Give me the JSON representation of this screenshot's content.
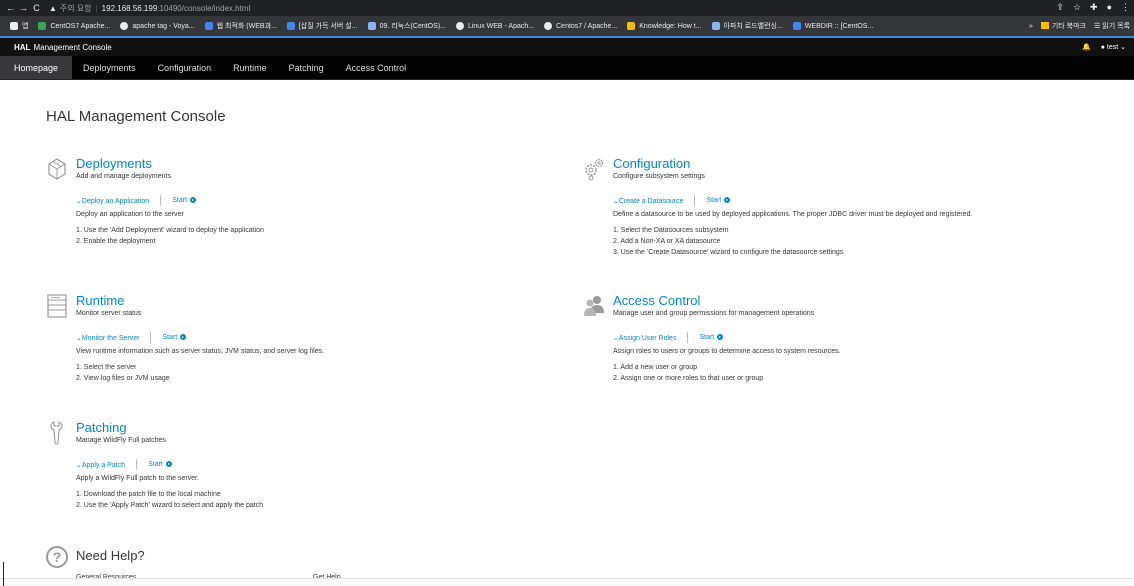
{
  "browser": {
    "back_icon": "←",
    "forward_icon": "→",
    "reload_icon": "C",
    "warning_icon": "▲",
    "insecure_label": "주의 요함",
    "url_host": "192.168.56.199",
    "url_path": ":10490/console/index.html",
    "right_icons": [
      "share-icon",
      "star-icon",
      "extension-icon",
      "profile-icon",
      "menu-icon"
    ],
    "bookmarks": [
      {
        "label": "앱",
        "color": "#e8eaed"
      },
      {
        "label": "CentOS7 Apache...",
        "color": "#34a853"
      },
      {
        "label": "apache tag - Voya...",
        "color": "#e8eaed"
      },
      {
        "label": "웹 최적화 (WEB과...",
        "color": "#4285f4"
      },
      {
        "label": "[삽질 가득 서버 설...",
        "color": "#4285f4"
      },
      {
        "label": "09. 리눅스(CentOS)...",
        "color": "#8ab4f8"
      },
      {
        "label": "Linux WEB - Apach...",
        "color": "#e8eaed"
      },
      {
        "label": "Centos7 / Apache...",
        "color": "#e8eaed"
      },
      {
        "label": "Knowledge: How t...",
        "color": "#fbbc04"
      },
      {
        "label": "아파치 로드밸런싱...",
        "color": "#8ab4f8"
      },
      {
        "label": "WEBDIR :: [CentOS...",
        "color": "#4285f4"
      }
    ],
    "overflow": "»",
    "other_bookmarks": "기타 북마크",
    "reading_list": "읽기 목록"
  },
  "header": {
    "brand_bold": "HAL",
    "brand_rest": "Management Console",
    "bell_icon": "bell-icon",
    "user_label": "test"
  },
  "nav": {
    "tabs": [
      "Homepage",
      "Deployments",
      "Configuration",
      "Runtime",
      "Patching",
      "Access Control"
    ],
    "active": "Homepage"
  },
  "main": {
    "title": "HAL Management Console",
    "sections": {
      "deployments": {
        "title": "Deployments",
        "subtitle": "Add and manage deployments",
        "action": "Deploy an Application",
        "start": "Start",
        "desc": "Deploy an application to the server",
        "steps": [
          "1. Use the 'Add Deployment' wizard to deploy the application",
          "2. Enable the deployment"
        ]
      },
      "configuration": {
        "title": "Configuration",
        "subtitle": "Configure subsystem settings",
        "action": "Create a Datasource",
        "start": "Start",
        "desc": "Define a datasource to be used by deployed applications. The proper JDBC driver must be deployed and registered.",
        "steps": [
          "1. Select the Datasources subsystem",
          "2. Add a Non-XA or XA datasource",
          "3. Use the 'Create Datasource' wizard to configure the datasource settings"
        ]
      },
      "runtime": {
        "title": "Runtime",
        "subtitle": "Monitor server status",
        "action": "Monitor the Server",
        "start": "Start",
        "desc": "View runtime information such as server status, JVM status, and server log files.",
        "steps": [
          "1. Select the server",
          "2. View log files or JVM usage"
        ]
      },
      "access": {
        "title": "Access Control",
        "subtitle": "Manage user and group permissions for management operations",
        "action": "Assign User Roles",
        "start": "Start",
        "desc": "Assign roles to users or groups to determine access to system resources.",
        "steps": [
          "1. Add a new user or group",
          "2. Assign one or more roles to that user or group"
        ]
      },
      "patching": {
        "title": "Patching",
        "subtitle": "Manage WildFly Full patches",
        "action": "Apply a Patch",
        "start": "Start",
        "desc": "Apply a WildFly Full patch to the server.",
        "steps": [
          "1. Download the patch file to the local machine",
          "2. Use the 'Apply Patch' wizard to select and apply the patch"
        ]
      }
    },
    "help": {
      "title": "Need Help?",
      "col1": "General Resources",
      "col2": "Get Help"
    }
  },
  "colors": {
    "link": "#0088ce",
    "nav_bg": "#030303",
    "active_tab": "#39393b",
    "accent_line": "#3b8ddb"
  }
}
